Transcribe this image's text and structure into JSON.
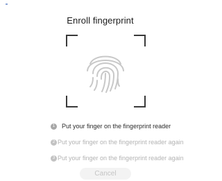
{
  "title": "Enroll fingerprint",
  "icons": {
    "fingerprint": "fingerprint-icon",
    "scan_frame": "scan-frame"
  },
  "steps": [
    {
      "number": "1",
      "text": "Put your finger on the fingerprint reader",
      "state": "active"
    },
    {
      "number": "2",
      "text": "Put your finger on the fingerprint reader again",
      "state": "pending"
    },
    {
      "number": "3",
      "text": "Put your finger on the fingerprint reader again",
      "state": "pending"
    }
  ],
  "actions": {
    "cancel_label": "Cancel"
  },
  "colors": {
    "active_text": "#2a2a2a",
    "pending_text": "#b3b3b3",
    "fingerprint": "#c8c8c8",
    "frame": "#3a3a3a"
  }
}
